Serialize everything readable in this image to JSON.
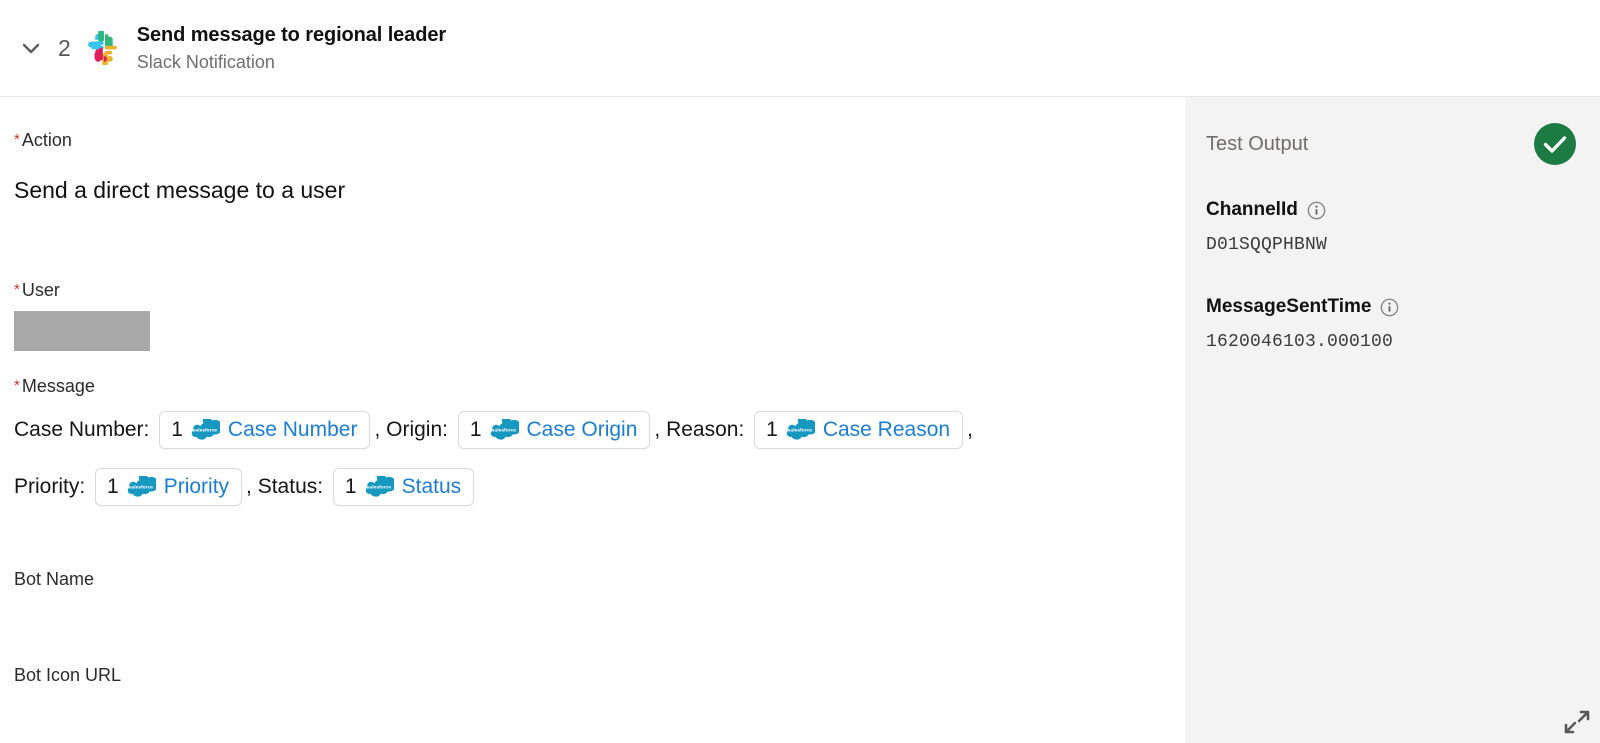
{
  "header": {
    "collapse_icon": "chevron-down-icon",
    "step_number": "2",
    "app_icon": "slack-icon",
    "title": "Send message to regional leader",
    "subtitle": "Slack Notification"
  },
  "form": {
    "action": {
      "label": "Action",
      "required_marker": "*",
      "value": "Send a direct message to a user"
    },
    "user": {
      "label": "User",
      "required_marker": "*",
      "value": ""
    },
    "message": {
      "label": "Message",
      "required_marker": "*",
      "lines": [
        {
          "segments": [
            {
              "kind": "text",
              "text": "Case Number: "
            },
            {
              "kind": "pill",
              "index": "1",
              "icon": "salesforce-icon",
              "label": "Case Number"
            },
            {
              "kind": "text",
              "text": ", Origin: "
            },
            {
              "kind": "pill",
              "index": "1",
              "icon": "salesforce-icon",
              "label": "Case Origin"
            },
            {
              "kind": "text",
              "text": ", Reason: "
            },
            {
              "kind": "pill",
              "index": "1",
              "icon": "salesforce-icon",
              "label": "Case Reason"
            },
            {
              "kind": "text",
              "text": ","
            }
          ]
        },
        {
          "segments": [
            {
              "kind": "text",
              "text": "Priority: "
            },
            {
              "kind": "pill",
              "index": "1",
              "icon": "salesforce-icon",
              "label": "Priority"
            },
            {
              "kind": "text",
              "text": ", Status: "
            },
            {
              "kind": "pill",
              "index": "1",
              "icon": "salesforce-icon",
              "label": "Status"
            }
          ]
        }
      ]
    },
    "bot_name": {
      "label": "Bot Name",
      "value": ""
    },
    "bot_icon_url": {
      "label": "Bot Icon URL",
      "value": ""
    }
  },
  "test_output": {
    "title": "Test Output",
    "status_icon": "success-check-icon",
    "entries": [
      {
        "key": "ChannelId",
        "info_icon": "info-icon",
        "value": "D01SQQPHBNW"
      },
      {
        "key": "MessageSentTime",
        "info_icon": "info-icon",
        "value": "1620046103.000100"
      }
    ]
  },
  "resize_handle_icon": "expand-diagonal-icon",
  "colors": {
    "required_star": "#c23934",
    "pill_label": "#1a7fd4",
    "success_green": "#1c7a43",
    "panel_background": "#f3f3f3",
    "redacted_block": "#a8a8a8"
  }
}
